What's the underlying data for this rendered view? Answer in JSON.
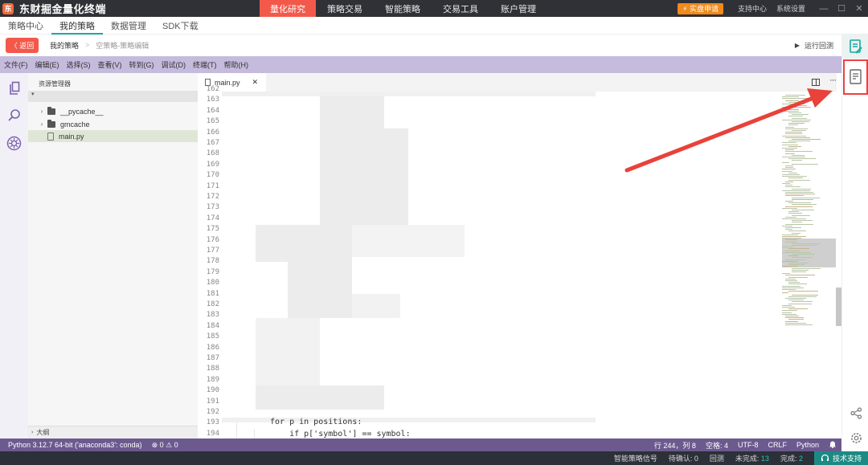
{
  "app": {
    "logo_glyph": "东",
    "title": "东财掘金量化终端",
    "main_nav": [
      "量化研究",
      "策略交易",
      "智能策略",
      "交易工具",
      "账户管理"
    ],
    "main_nav_active": "量化研究",
    "live_button": "⚡ 实盘申请",
    "support": "支持中心",
    "settings": "系统设置",
    "window_controls": [
      "—",
      "☐",
      "✕"
    ]
  },
  "subnav": {
    "items": [
      "策略中心",
      "我的策略",
      "数据管理",
      "SDK下载"
    ],
    "active": "我的策略"
  },
  "breadcrumb": {
    "back": "〈 返回",
    "root": "我的策略",
    "separator": ">",
    "current": "空策略-策略编辑",
    "run_back": "运行回测"
  },
  "menubar": [
    "文件(F)",
    "编辑(E)",
    "选择(S)",
    "查看(V)",
    "转到(G)",
    "调试(D)",
    "终端(T)",
    "帮助(H)"
  ],
  "explorer": {
    "title": "资源管理器",
    "items": [
      {
        "label": "__pycache__",
        "type": "folder"
      },
      {
        "label": "gmcache",
        "type": "folder"
      },
      {
        "label": "main.py",
        "type": "file"
      }
    ],
    "outline": "大纲"
  },
  "editor": {
    "tab_label": "main.py",
    "tab_close": "✕",
    "more": "···",
    "line_numbers": [
      "162",
      "163",
      "164",
      "165",
      "166",
      "167",
      "168",
      "169",
      "170",
      "171",
      "172",
      "173",
      "174",
      "175",
      "176",
      "177",
      "178",
      "179",
      "180",
      "181",
      "182",
      "183",
      "184",
      "185",
      "186",
      "187",
      "188",
      "189",
      "190",
      "191",
      "192",
      "193",
      "194"
    ],
    "visible_code": [
      {
        "line": "193",
        "text": "for p in positions:"
      },
      {
        "line": "194",
        "text": "    if p['symbol'] == symbol:"
      }
    ]
  },
  "statusbar": {
    "interpreter": "Python 3.12.7 64-bit ('anaconda3': conda)",
    "problems": "⊗ 0 ⚠ 0",
    "position": "行 244，列 8",
    "spaces": "空格: 4",
    "encoding": "UTF-8",
    "eol": "CRLF",
    "language": "Python"
  },
  "bottombar": {
    "signal": "智能策略信号",
    "pending_label": "待确认:",
    "pending": "0",
    "backtest": "回测",
    "incomplete_label": "未完成:",
    "incomplete": "13",
    "done_label": "完成:",
    "done": "2",
    "tech_support": "技术支持"
  },
  "colors": {
    "titlebar": "#2f3136",
    "accent_red": "#f3594b",
    "menubar": "#c5bbdc",
    "statusbar": "#6c5a8f",
    "teal": "#1aa7a0",
    "annotation": "#e8423a"
  }
}
